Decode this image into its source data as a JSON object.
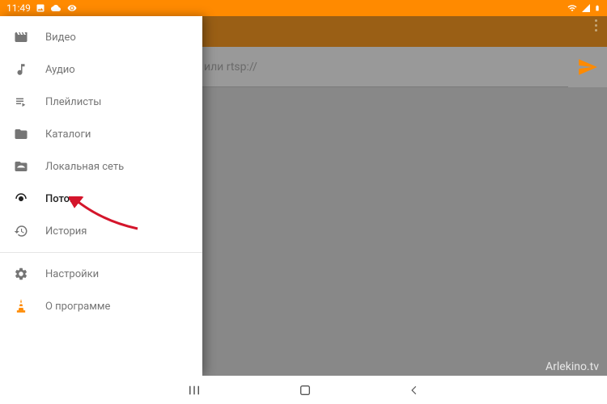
{
  "status_bar": {
    "time": "11:49"
  },
  "app": {
    "stream_placeholder": "или rtsp://"
  },
  "drawer": {
    "items": [
      {
        "label": "Видео",
        "icon": "video"
      },
      {
        "label": "Аудио",
        "icon": "music"
      },
      {
        "label": "Плейлисты",
        "icon": "playlist"
      },
      {
        "label": "Каталоги",
        "icon": "folder"
      },
      {
        "label": "Локальная сеть",
        "icon": "network-folder"
      },
      {
        "label": "Поток",
        "icon": "stream",
        "active": true
      },
      {
        "label": "История",
        "icon": "history"
      }
    ],
    "footer_items": [
      {
        "label": "Настройки",
        "icon": "settings"
      },
      {
        "label": "О программе",
        "icon": "vlc-cone"
      }
    ]
  },
  "watermark": "Arlekino.tv",
  "colors": {
    "accent": "#ff8a00"
  }
}
